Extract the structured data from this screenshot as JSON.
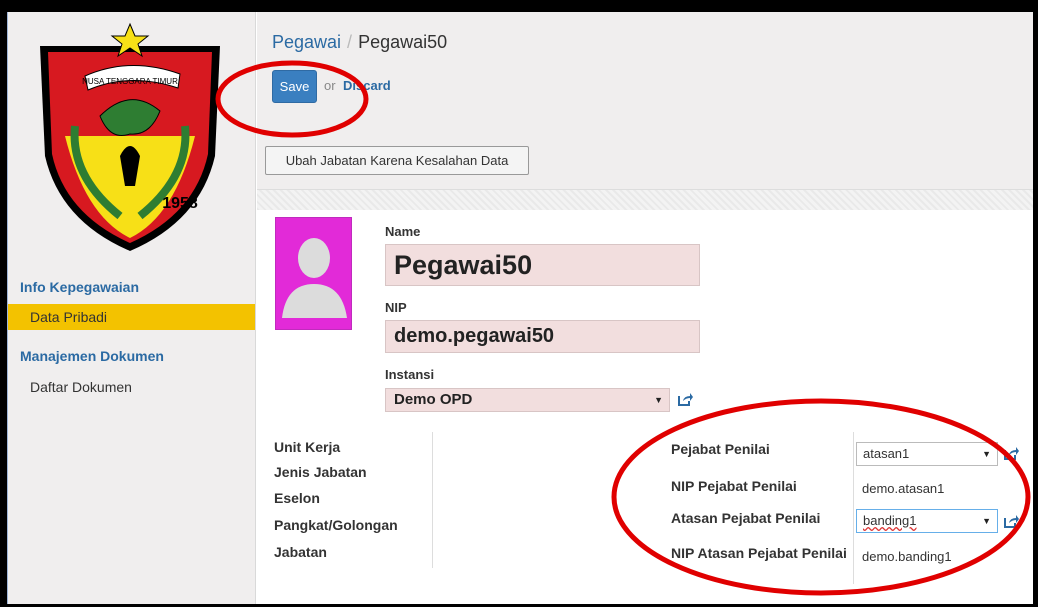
{
  "sidebar": {
    "sections": [
      {
        "title": "Info Kepegawaian",
        "items": [
          "Data Pribadi"
        ]
      },
      {
        "title": "Manajemen Dokumen",
        "items": [
          "Daftar Dokumen"
        ]
      }
    ],
    "logo_text": "NUSA TENGGARA TIMUR",
    "logo_year": "1958"
  },
  "header": {
    "breadcrumb_parent": "Pegawai",
    "breadcrumb_sep": "/",
    "breadcrumb_current": "Pegawai50",
    "save_label": "Save",
    "or_label": "or",
    "discard_label": "Discard",
    "action_button": "Ubah Jabatan Karena Kesalahan Data"
  },
  "form": {
    "name_label": "Name",
    "name_value": "Pegawai50",
    "nip_label": "NIP",
    "nip_value": "demo.pegawai50",
    "instansi_label": "Instansi",
    "instansi_value": "Demo OPD",
    "left_labels": [
      "Unit Kerja",
      "Jenis Jabatan",
      "Eselon",
      "Pangkat/Golongan",
      "Jabatan"
    ],
    "pejabat_penilai_label": "Pejabat Penilai",
    "pejabat_penilai_value": "atasan1",
    "nip_pejabat_penilai_label": "NIP Pejabat Penilai",
    "nip_pejabat_penilai_value": "demo.atasan1",
    "atasan_pejabat_penilai_label": "Atasan Pejabat Penilai",
    "atasan_pejabat_penilai_value": "banding1",
    "nip_atasan_pejabat_penilai_label": "NIP Atasan Pejabat Penilai",
    "nip_atasan_pejabat_penilai_value": "demo.banding1"
  },
  "colors": {
    "accent": "#3a7fc0",
    "active_menu": "#f3c200",
    "required_field": "#f2dede",
    "annotation": "#e00000"
  },
  "icons": [
    "external-link-icon",
    "caret-down-icon",
    "avatar-placeholder-icon"
  ]
}
